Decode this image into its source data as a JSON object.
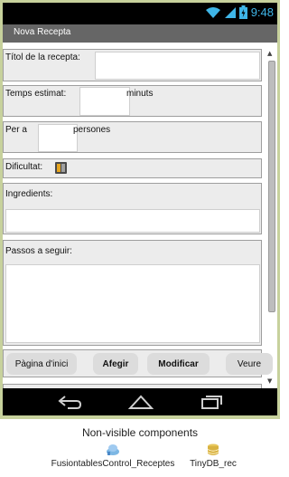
{
  "status_bar": {
    "time": "9:48"
  },
  "title_bar": {
    "title": "Nova Recepta"
  },
  "form": {
    "title_label": "Títol de la recepta:",
    "time_label": "Temps estimat:",
    "time_unit": "minuts",
    "serves_label": "Per a",
    "serves_unit": "persones",
    "difficulty_label": "Dificultat:",
    "ingredients_label": "Ingredients:",
    "steps_label": "Passos a seguir:"
  },
  "buttons": {
    "home": "Pàgina d'inici",
    "add": "Afegir",
    "modify": "Modificar",
    "view": "Veure"
  },
  "non_visible": {
    "title": "Non-visible components",
    "components": [
      "FusiontablesControl_Receptes",
      "TinyDB_rec"
    ]
  },
  "colors": {
    "frame": "#c7d19c",
    "title_bar": "#666666",
    "accent": "#3fb6e8"
  }
}
